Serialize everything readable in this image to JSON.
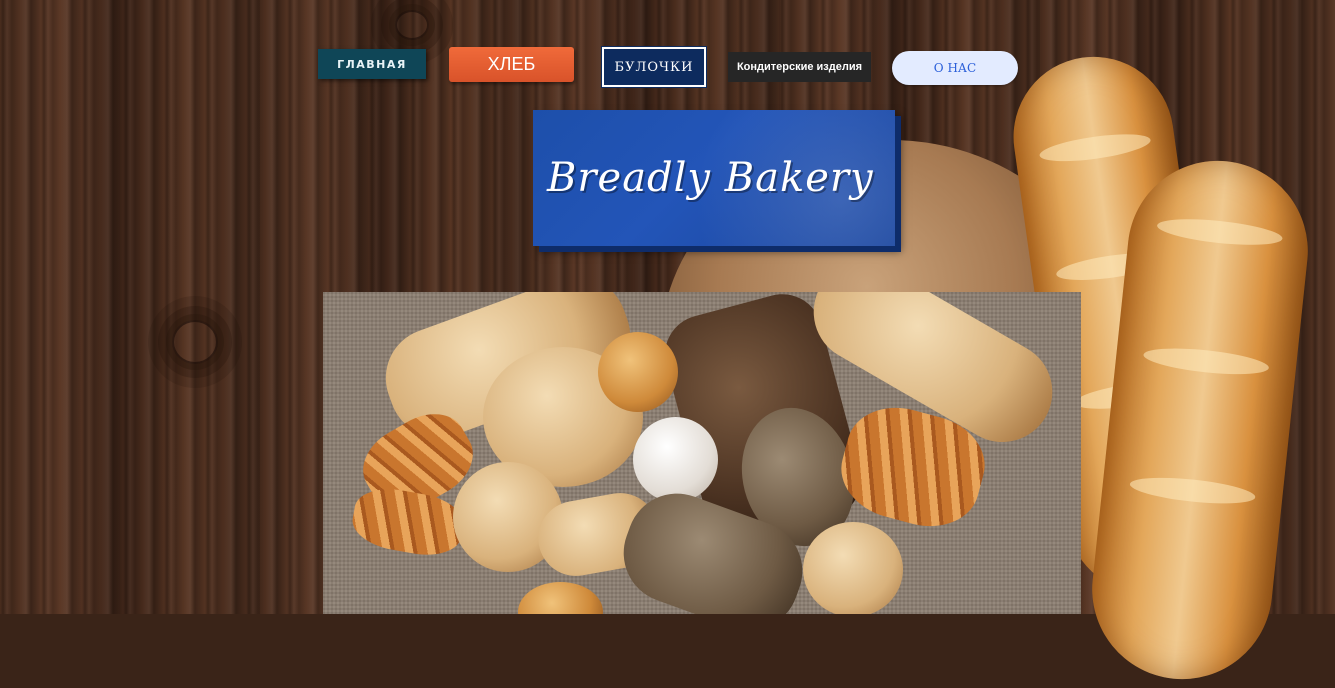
{
  "nav": {
    "home": "ГЛАВНАЯ",
    "bread": "ХЛЕБ",
    "buns": "БУЛОЧКИ",
    "pastry": "Кондитерские изделия",
    "about": "О НАС"
  },
  "hero": {
    "title": "Breadly Bakery"
  },
  "colors": {
    "home_bg": "#0f4657",
    "bread_bg": "#e55e32",
    "buns_bg": "#0d2b5e",
    "pastry_bg": "#262626",
    "about_bg": "#e3ebff",
    "title_bg": "#2355b8"
  }
}
